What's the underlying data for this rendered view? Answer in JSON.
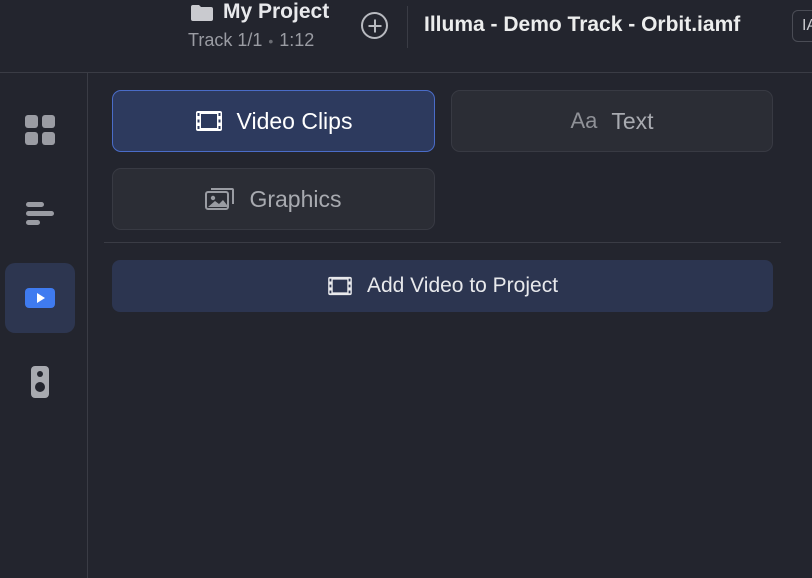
{
  "header": {
    "project_name": "My Project",
    "track_label": "Track 1/1",
    "track_separator": "•",
    "duration": "1:12",
    "file_title": "Illuma - Demo Track - Orbit.iamf",
    "right_chip_text": "IA"
  },
  "sidebar": {
    "items": [
      {
        "icon": "grid-icon"
      },
      {
        "icon": "align-lines-icon"
      },
      {
        "icon": "video-play-icon",
        "active": true
      },
      {
        "icon": "speaker-icon"
      }
    ]
  },
  "tabs": {
    "video_clips": "Video Clips",
    "text_prefix": "Aa",
    "text": "Text",
    "graphics": "Graphics"
  },
  "actions": {
    "add_video": "Add Video to Project"
  },
  "colors": {
    "background": "#23252e",
    "accent": "#4a6cc8",
    "active_tab": "#2d3a5e",
    "play_blue": "#3f7bf0"
  }
}
